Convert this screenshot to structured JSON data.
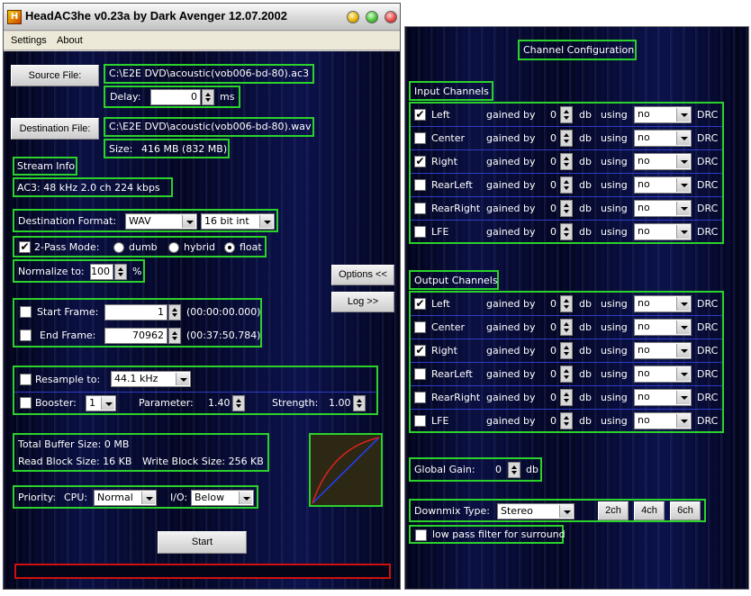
{
  "window": {
    "title": "HeadAC3he v0.23a by Dark Avenger 12.07.2002",
    "app_icon": "H"
  },
  "menu": {
    "items": [
      "Settings",
      "About"
    ]
  },
  "source": {
    "button": "Source File:",
    "path": "C:\\E2E DVD\\acoustic(vob006-bd-80).ac3",
    "delay_label": "Delay:",
    "delay_value": "0",
    "delay_unit": "ms"
  },
  "destination": {
    "button": "Destination File:",
    "path": "C:\\E2E DVD\\acoustic(vob006-bd-80).wav",
    "size_label": "Size:",
    "size_value": "416 MB  (832 MB)"
  },
  "stream_info": {
    "title": "Stream Info",
    "line": "AC3:  48 kHz   2.0 ch    224 kbps"
  },
  "format": {
    "label": "Destination Format:",
    "format_value": "WAV",
    "bits_value": "16 bit int"
  },
  "twopass": {
    "label": "2-Pass Mode:",
    "checked": "✔",
    "opt1": "dumb",
    "opt2": "hybrid",
    "opt3": "float"
  },
  "normalize": {
    "label": "Normalize to:",
    "value": "100",
    "unit": "%"
  },
  "side_buttons": {
    "options": "Options <<",
    "log": "Log >>"
  },
  "frames": {
    "start_label": "Start Frame:",
    "start_value": "1",
    "start_time": "(00:00:00.000)",
    "end_label": "End Frame:",
    "end_value": "70962",
    "end_time": "(00:37:50.784)"
  },
  "resample": {
    "label": "Resample to:",
    "value": "44.1 kHz",
    "booster_label": "Booster:",
    "booster_value": "1",
    "param_label": "Parameter:",
    "param_value": "1.40",
    "strength_label": "Strength:",
    "strength_value": "1.00"
  },
  "buffer": {
    "total": "Total Buffer Size:    0 MB",
    "read": "Read Block Size:  16 KB",
    "write": "Write Block Size:   256 KB"
  },
  "priority": {
    "label": "Priority:",
    "cpu_label": "CPU:",
    "cpu_value": "Normal",
    "io_label": "I/O:",
    "io_value": "Below"
  },
  "start_button": "Start",
  "channel_config": {
    "title": "Channel Configuration",
    "input_title": "Input Channels",
    "output_title": "Output Channels",
    "gained_by": "gained by",
    "db": "db",
    "using": "using",
    "drc": "DRC",
    "input": [
      {
        "name": "Left",
        "check": "✔",
        "gain": "0",
        "using": "no"
      },
      {
        "name": "Center",
        "check": "",
        "gain": "0",
        "using": "no"
      },
      {
        "name": "Right",
        "check": "✔",
        "gain": "0",
        "using": "no"
      },
      {
        "name": "RearLeft",
        "check": "",
        "gain": "0",
        "using": "no"
      },
      {
        "name": "RearRight",
        "check": "",
        "gain": "0",
        "using": "no"
      },
      {
        "name": "LFE",
        "check": "",
        "gain": "0",
        "using": "no"
      }
    ],
    "output": [
      {
        "name": "Left",
        "check": "✔",
        "gain": "0",
        "using": "no"
      },
      {
        "name": "Center",
        "check": "",
        "gain": "0",
        "using": "no"
      },
      {
        "name": "Right",
        "check": "✔",
        "gain": "0",
        "using": "no"
      },
      {
        "name": "RearLeft",
        "check": "",
        "gain": "0",
        "using": "no"
      },
      {
        "name": "RearRight",
        "check": "",
        "gain": "0",
        "using": "no"
      },
      {
        "name": "LFE",
        "check": "",
        "gain": "0",
        "using": "no"
      }
    ],
    "global_gain": {
      "label": "Global Gain:",
      "value": "0",
      "unit": "db"
    },
    "downmix": {
      "label": "Downmix Type:",
      "value": "Stereo",
      "btn2": "2ch",
      "btn4": "4ch",
      "btn6": "6ch"
    },
    "lowpass": {
      "label": "low pass filter for surround",
      "check": ""
    }
  },
  "colors": {
    "accent_green": "#2bd22b",
    "panel_dark": "#05072a",
    "curve_red": "#e02020",
    "curve_blue": "#2040ff"
  }
}
